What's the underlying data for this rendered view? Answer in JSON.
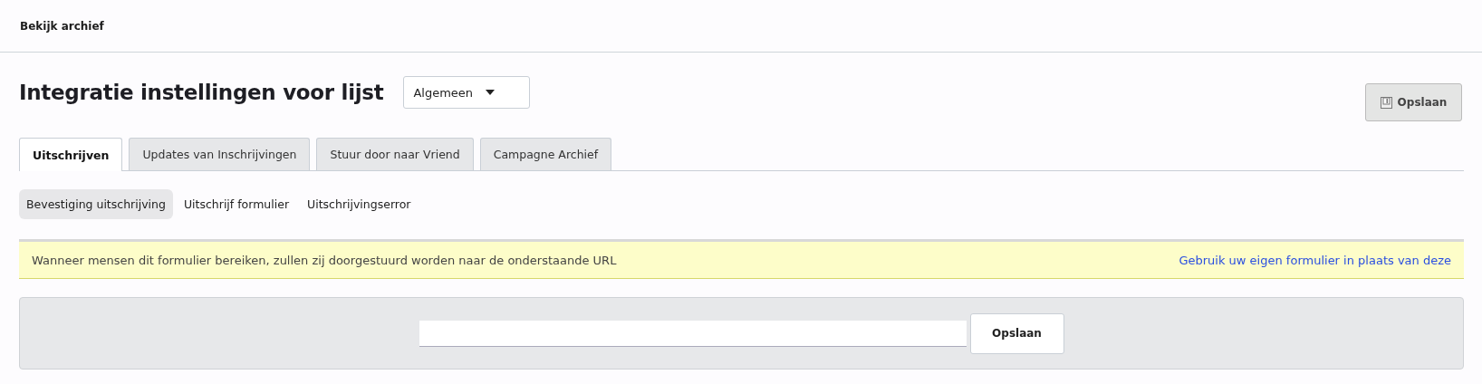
{
  "header": {
    "link": "Bekijk archief"
  },
  "title": "Integratie instellingen voor lijst",
  "dropdown": {
    "value": "Algemeen"
  },
  "save_button": "Opslaan",
  "tabs": [
    {
      "label": "Uitschrijven",
      "selected": true
    },
    {
      "label": "Updates van Inschrijvingen",
      "selected": false
    },
    {
      "label": "Stuur door naar Vriend",
      "selected": false
    },
    {
      "label": "Campagne Archief",
      "selected": false
    }
  ],
  "subtabs": [
    {
      "label": "Bevestiging uitschrijving",
      "selected": true
    },
    {
      "label": "Uitschrijf formulier",
      "selected": false
    },
    {
      "label": "Uitschrijvingserror",
      "selected": false
    }
  ],
  "notice": {
    "text": "Wanneer mensen dit formulier bereiken, zullen zij doorgestuurd worden naar de onderstaande URL",
    "link": "Gebruik uw eigen formulier in plaats van deze"
  },
  "url_form": {
    "button": "Opslaan"
  }
}
